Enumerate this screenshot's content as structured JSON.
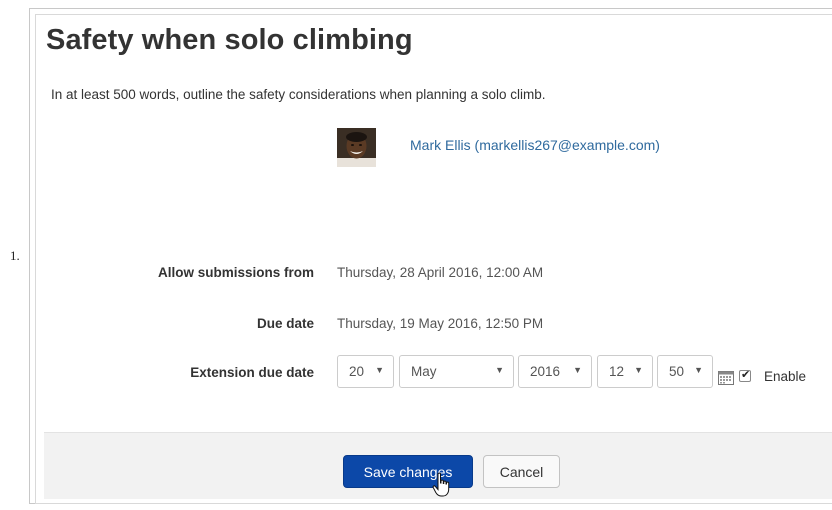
{
  "list_marker": "1.",
  "page": {
    "title": "Safety when solo climbing",
    "intro": "In at least 500 words, outline the safety considerations when planning a solo climb."
  },
  "user": {
    "name": "Mark Ellis (markellis267@example.com)",
    "avatar_icon": "user-avatar-photo"
  },
  "form": {
    "allow_label": "Allow submissions from",
    "allow_value": "Thursday, 28 April 2016, 12:00 AM",
    "due_label": "Due date",
    "due_value": "Thursday, 19 May 2016, 12:50 PM",
    "extension_label": "Extension due date",
    "extension": {
      "day": "20",
      "month": "May",
      "year": "2016",
      "hour": "12",
      "minute": "50",
      "caret": "▼",
      "calendar_icon": "calendar-icon",
      "enable_checked": true,
      "enable_mark": "✔",
      "enable_label": "Enable"
    }
  },
  "buttons": {
    "save": "Save changes",
    "cancel": "Cancel"
  },
  "colors": {
    "primary": "#0c48a8",
    "link": "#2f6a9e",
    "footer_bg": "#f2f2f2"
  }
}
